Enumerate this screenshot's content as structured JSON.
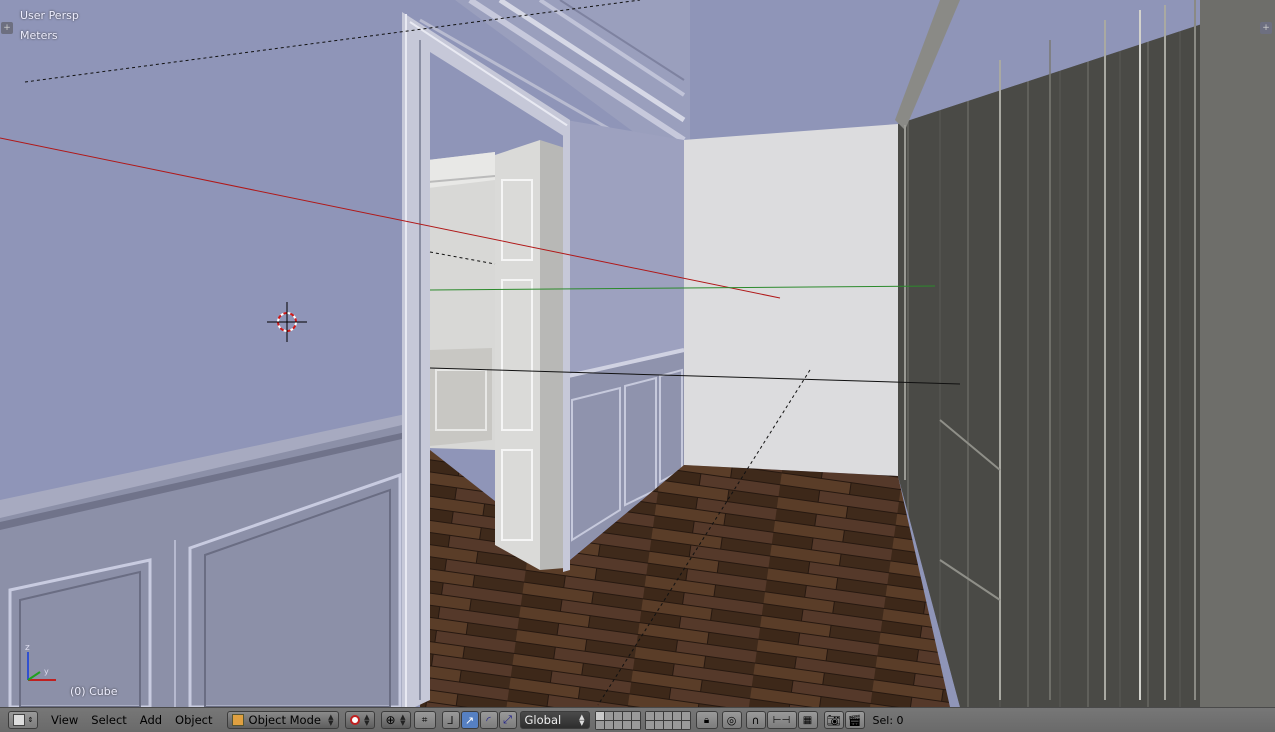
{
  "viewport": {
    "view_name": "User Persp",
    "units": "Meters",
    "object_info": "(0) Cube",
    "axis_labels": {
      "z": "z",
      "y": "y"
    }
  },
  "header": {
    "editor_type_icon": "cube-3d-icon",
    "menus": [
      "View",
      "Select",
      "Add",
      "Object"
    ],
    "mode": "Object Mode",
    "orientation": "Global",
    "status": "Sel: 0"
  },
  "colors": {
    "wall": "#8f95b8",
    "header_bg": "#727272",
    "x_axis": "#b01818",
    "y_axis": "#2c8a2c",
    "floor": "#4a3424",
    "dark_wall": "#4a4a46"
  }
}
